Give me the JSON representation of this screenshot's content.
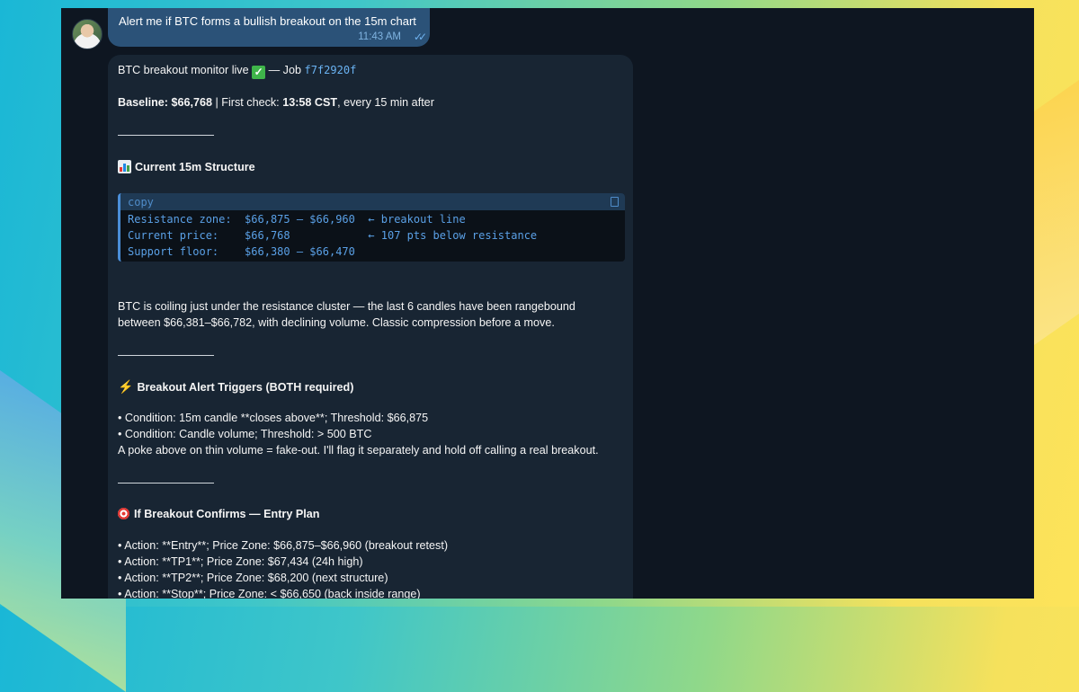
{
  "outgoing": {
    "text": "Alert me if BTC forms a bullish breakout on the 15m chart",
    "time": "11:43 AM",
    "ticks": "✓✓"
  },
  "reply": {
    "intro_prefix": "BTC breakout monitor live",
    "intro_mid": " — Job ",
    "job_id": "f7f2920f",
    "baseline_label": "Baseline: $66,768",
    "first_check_label": " | First check: ",
    "first_check_time": "13:58 CST",
    "first_check_suffix": ", every 15 min after",
    "section1_title": "Current 15m Structure",
    "code": {
      "copy_label": "copy",
      "rows": [
        "Resistance zone:  $66,875 – $66,960  ← breakout line",
        "Current price:    $66,768            ← 107 pts below resistance",
        "Support floor:    $66,380 – $66,470"
      ]
    },
    "para1_line1": "BTC is coiling just under the resistance cluster — the last 6 candles have been rangebound",
    "para1_line2": "between $66,381–$66,782, with declining volume. Classic compression before a move.",
    "section2_title": "Breakout Alert Triggers (BOTH required)",
    "trigger1": "• Condition: 15m candle **closes above**; Threshold: $66,875",
    "trigger2": "• Condition: Candle volume; Threshold: > 500 BTC",
    "trigger_note": "A poke above on thin volume = fake-out. I'll flag it separately and hold off calling a real breakout.",
    "section3_title": "If Breakout Confirms — Entry Plan",
    "plan": [
      "• Action: **Entry**; Price Zone: $66,875–$66,960 (breakout retest)",
      "• Action: **TP1**; Price Zone: $67,434 (24h high)",
      "• Action: **TP2**; Price Zone: $68,200 (next structure)",
      "• Action: **Stop**; Price Zone: < $66,650 (back inside range)"
    ]
  },
  "icons": {
    "check": "check-mark-icon",
    "chart": "bar-chart-icon",
    "bolt": "lightning-icon",
    "target": "target-icon",
    "copy": "copy-icon"
  }
}
